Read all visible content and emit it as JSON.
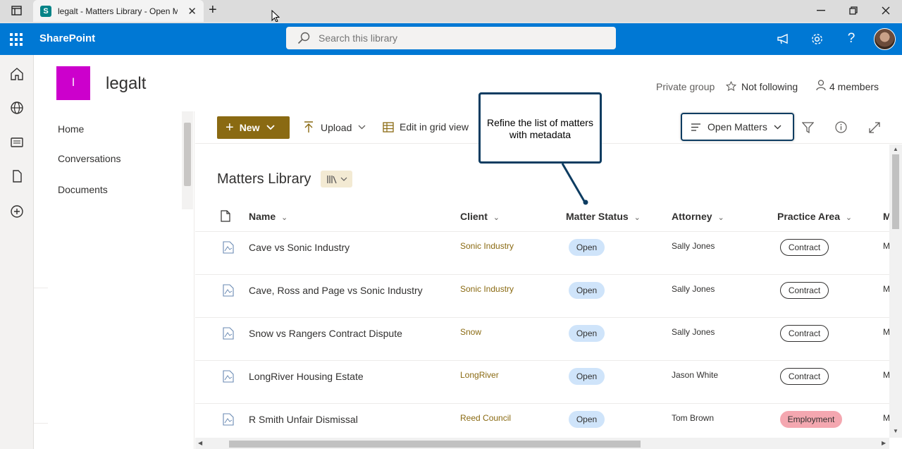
{
  "browser": {
    "tab_title": "legalt - Matters Library - Open M",
    "favicon_letter": "S",
    "new_tab": "+",
    "close": "✕"
  },
  "suite": {
    "brand": "SharePoint",
    "search_placeholder": "Search this library"
  },
  "site": {
    "logo_letter": "l",
    "title": "legalt",
    "privacy": "Private group",
    "follow": "Not following",
    "members": "4 members"
  },
  "nav": {
    "items": [
      {
        "label": "Home"
      },
      {
        "label": "Conversations"
      },
      {
        "label": "Documents"
      }
    ]
  },
  "command_bar": {
    "new_label": "New",
    "upload_label": "Upload",
    "grid_label": "Edit in grid view",
    "view_label": "Open Matters"
  },
  "callout": {
    "text": "Refine the list of matters with metadata"
  },
  "library": {
    "title": "Matters Library",
    "columns": {
      "name": "Name",
      "client": "Client",
      "status": "Matter Status",
      "attorney": "Attorney",
      "area": "Practice Area",
      "next": "M"
    },
    "rows": [
      {
        "name": "Cave vs Sonic Industry",
        "client": "Sonic Industry",
        "status": "Open",
        "attorney": "Sally Jones",
        "area": "Contract",
        "next": "M"
      },
      {
        "name": "Cave, Ross and Page vs Sonic Industry",
        "client": "Sonic Industry",
        "status": "Open",
        "attorney": "Sally Jones",
        "area": "Contract",
        "next": "M"
      },
      {
        "name": "Snow vs Rangers Contract Dispute",
        "client": "Snow",
        "status": "Open",
        "attorney": "Sally Jones",
        "area": "Contract",
        "next": "M"
      },
      {
        "name": "LongRiver Housing Estate",
        "client": "LongRiver",
        "status": "Open",
        "attorney": "Jason White",
        "area": "Contract",
        "next": "M"
      },
      {
        "name": "R Smith Unfair Dismissal",
        "client": "Reed Council",
        "status": "Open",
        "attorney": "Tom Brown",
        "area": "Employment",
        "next": "M"
      }
    ]
  },
  "colors": {
    "suite_blue": "#0078d4",
    "accent_gold": "#8a6a12",
    "site_logo": "#cc00cc",
    "status_open": "#cfe4fa",
    "employment_tag": "#f4a7b0",
    "callout_border": "#0d3c61"
  }
}
